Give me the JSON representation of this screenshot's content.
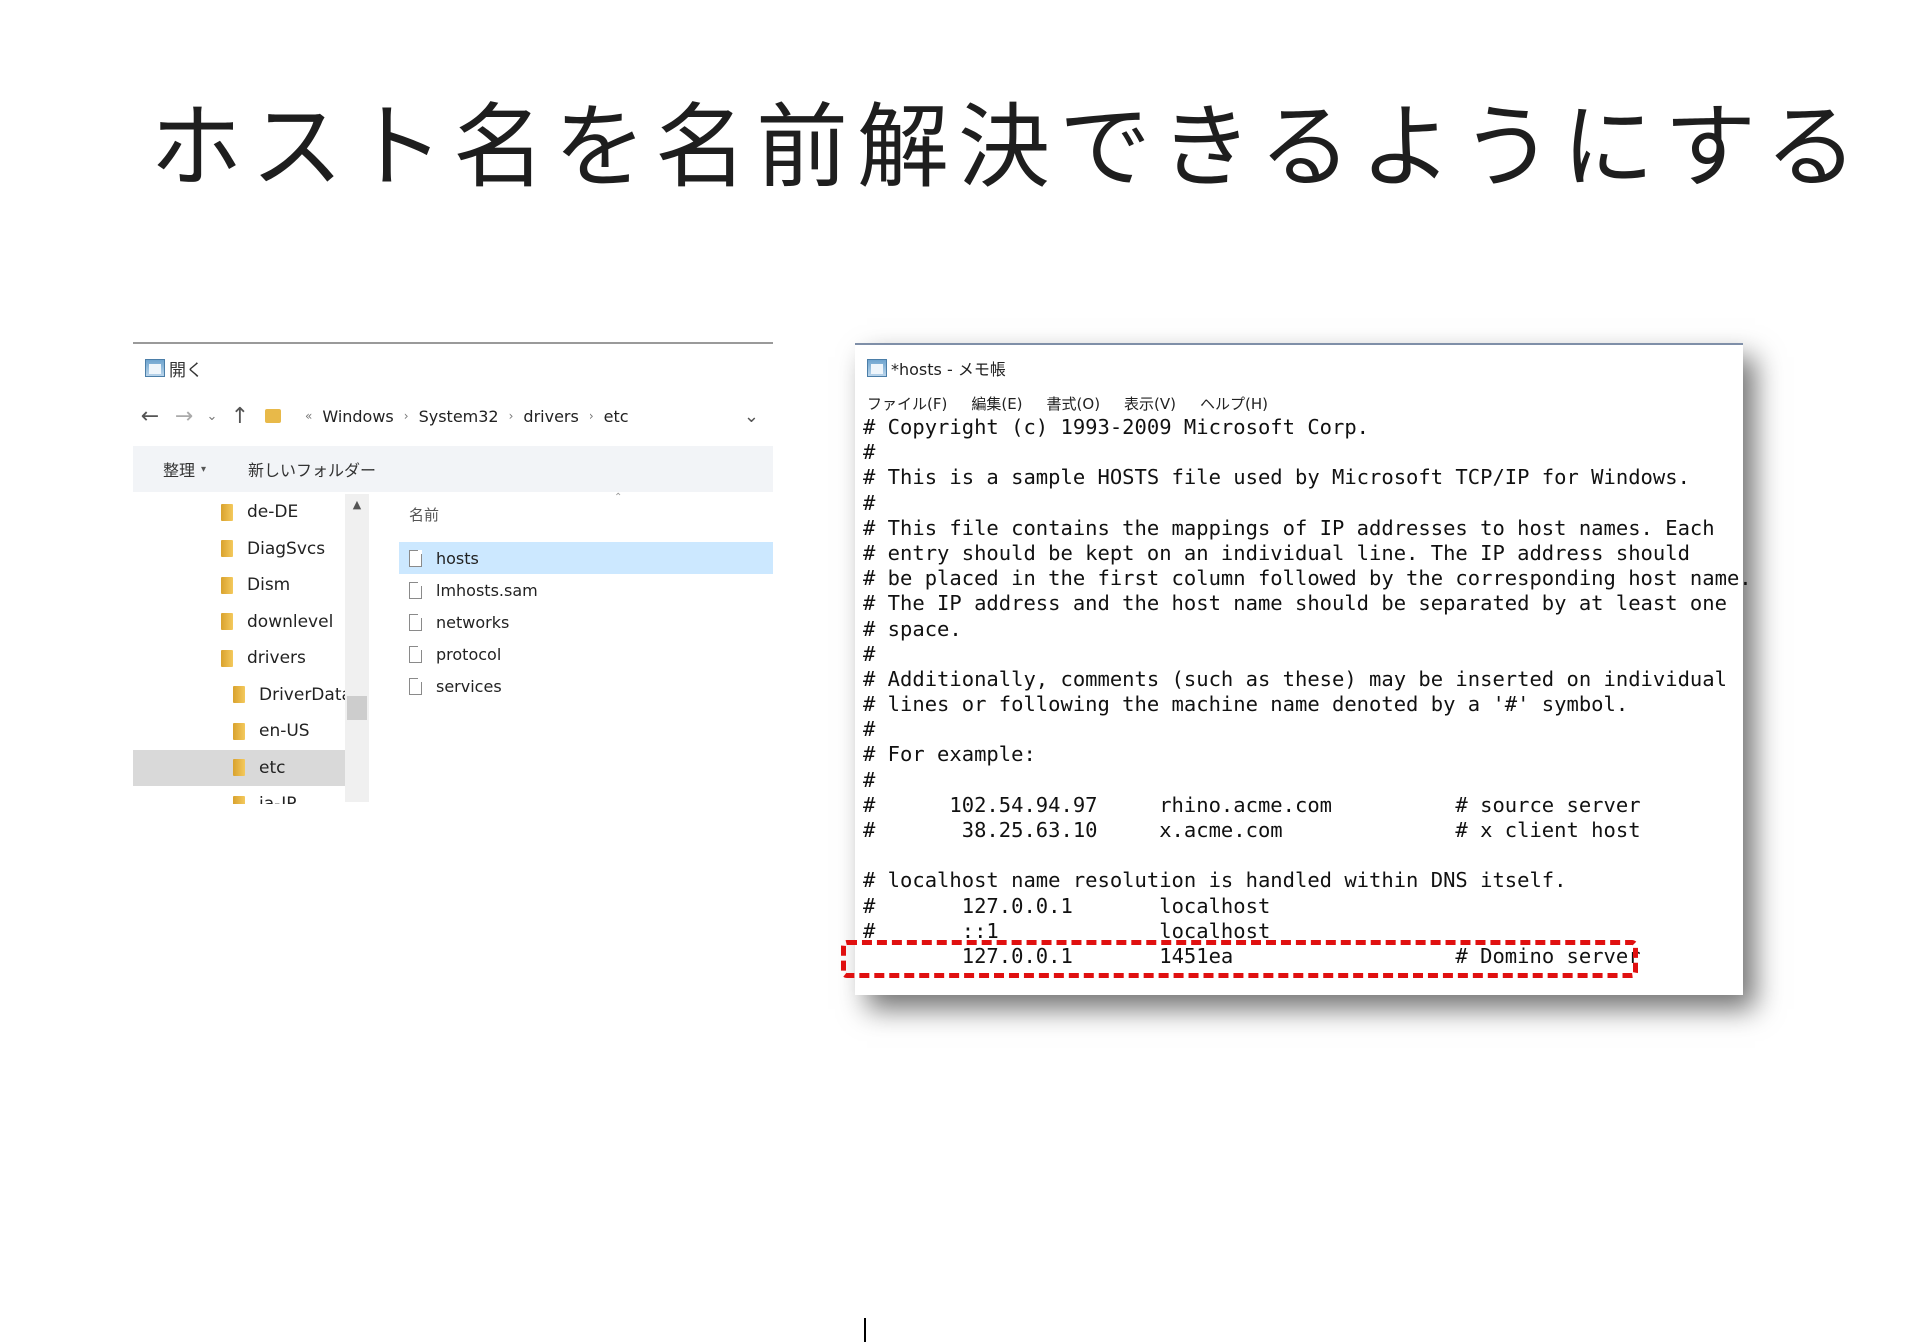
{
  "slide": {
    "title": "ホスト名を名前解決できるようにする"
  },
  "explorer": {
    "window_title": "開く",
    "nav": {
      "back": "←",
      "forward": "→",
      "recent": "⌄",
      "up": "↑"
    },
    "breadcrumb": [
      "Windows",
      "System32",
      "drivers",
      "etc"
    ],
    "breadcrumb_prefix": "«",
    "toolbar": {
      "organize": "整理",
      "new_folder": "新しいフォルダー"
    },
    "tree": [
      {
        "label": "de-DE"
      },
      {
        "label": "DiagSvcs"
      },
      {
        "label": "Dism"
      },
      {
        "label": "downlevel"
      },
      {
        "label": "drivers"
      },
      {
        "label": "DriverData"
      },
      {
        "label": "en-US"
      },
      {
        "label": "etc",
        "selected": true
      },
      {
        "label": "ja-JP"
      }
    ],
    "column_header": "名前",
    "files": [
      {
        "name": "hosts",
        "selected": true
      },
      {
        "name": "lmhosts.sam"
      },
      {
        "name": "networks"
      },
      {
        "name": "protocol"
      },
      {
        "name": "services"
      }
    ]
  },
  "notepad": {
    "window_title": "*hosts - メモ帳",
    "menu": [
      "ファイル(F)",
      "編集(E)",
      "書式(O)",
      "表示(V)",
      "ヘルプ(H)"
    ],
    "lines": [
      "# Copyright (c) 1993-2009 Microsoft Corp.",
      "#",
      "# This is a sample HOSTS file used by Microsoft TCP/IP for Windows.",
      "#",
      "# This file contains the mappings of IP addresses to host names. Each",
      "# entry should be kept on an individual line. The IP address should",
      "# be placed in the first column followed by the corresponding host name.",
      "# The IP address and the host name should be separated by at least one",
      "# space.",
      "#",
      "# Additionally, comments (such as these) may be inserted on individual",
      "# lines or following the machine name denoted by a '#' symbol.",
      "#",
      "# For example:",
      "#",
      "#      102.54.94.97     rhino.acme.com          # source server",
      "#       38.25.63.10     x.acme.com              # x client host",
      "",
      "# localhost name resolution is handled within DNS itself.",
      "#\t127.0.0.1       localhost",
      "#\t::1             localhost",
      " \t127.0.0.1       1451ea                  # Domino server"
    ],
    "highlight_color": "#e01010"
  }
}
